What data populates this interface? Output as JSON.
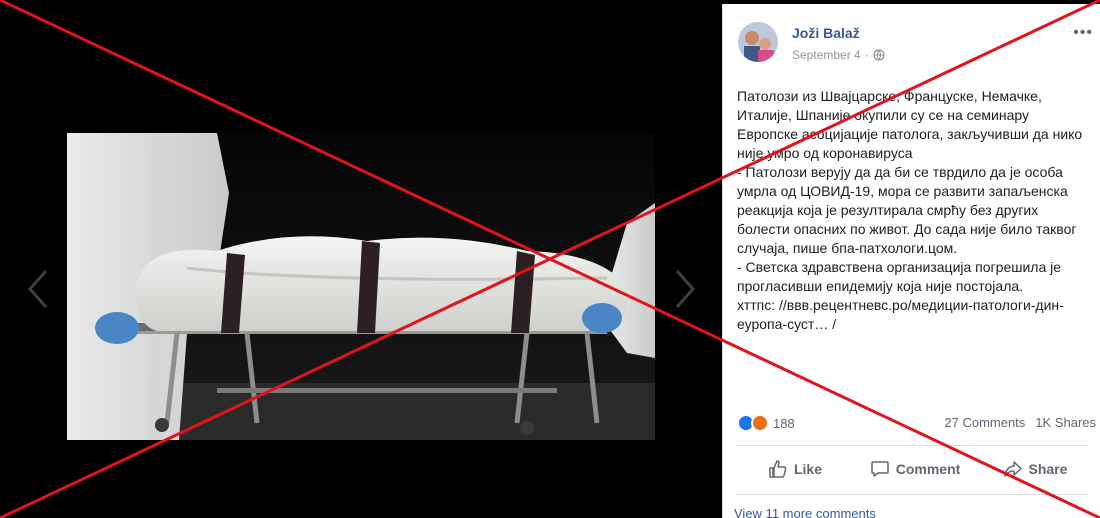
{
  "viewer": {
    "caption": "",
    "prev_icon": "chevron-left-icon",
    "next_icon": "chevron-right-icon"
  },
  "post": {
    "author": "Joži Balaž",
    "date": "September 4",
    "separator": "·",
    "privacy_icon": "globe-icon",
    "more_label": "•••",
    "paragraphs": [
      "Патолози из Швајцарске, Француске, Немачке, Италије, Шпаније окупили су се на семинару Европске асоцијације патолога, закључивши да нико није умро од коронавируса",
      "- Патолози верују да да би се тврдило да је особа умрла од ЦОВИД-19, мора се развити запаљенска реакција која је резултирала смрћу без других болести опасних по живот. До сада није било таквог случаја, пише бпа-патхологи.цом.",
      "- Светска здравствена организација погрешила је прогласивши епидемију која није постојала."
    ],
    "link_text": "хттпс: //ввв.рецентневс.ро/медиции-патологи-дин-еуропа-суст… /"
  },
  "stats": {
    "reaction_count": "188",
    "comments": "27 Comments",
    "shares": "1K Shares"
  },
  "actions": {
    "like": "Like",
    "comment": "Comment",
    "share": "Share"
  },
  "more_comments": "View 11 more comments",
  "colors": {
    "link_blue": "#385898",
    "overlay_red": "#e0141b",
    "like_blue": "#1877f2",
    "angry_orange": "#e9710f"
  }
}
